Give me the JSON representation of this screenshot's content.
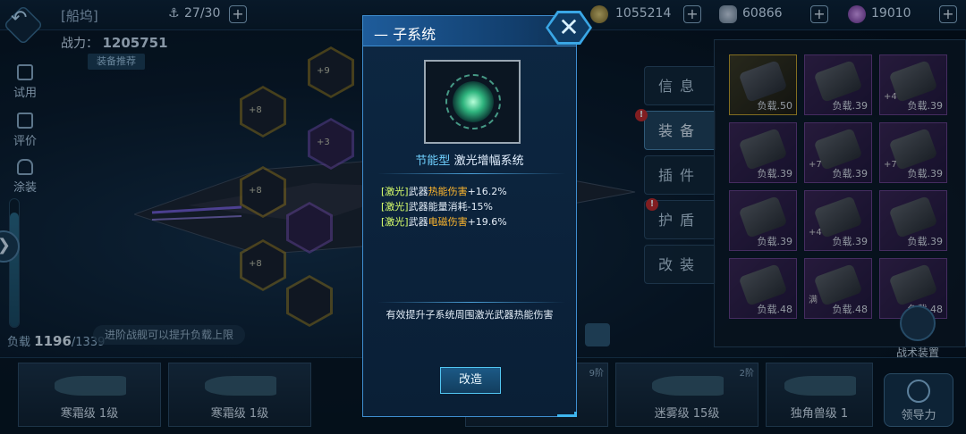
{
  "topbar": {
    "breadcrumb": "[船坞]",
    "fleet_count": "27/30",
    "gold": "1055214",
    "crystal": "60866",
    "gem": "19010"
  },
  "left": {
    "power_label": "战力：",
    "power_value": "1205751",
    "recommend": "装备推荐",
    "side_buttons": [
      "试用",
      "评价",
      "涂装"
    ],
    "load_label": "负载",
    "load_current": "1196",
    "load_max": "/1339",
    "load_fraction": 0.893,
    "hint": "进阶战舰可以提升负载上限"
  },
  "hex_badges": [
    "+9",
    "+8",
    "+3",
    "+8",
    "+8"
  ],
  "right_tabs": [
    "信息",
    "装备",
    "插件",
    "护盾",
    "改装"
  ],
  "tab_badge": "!",
  "inventory": [
    {
      "plus": "",
      "cap": "负载.50"
    },
    {
      "plus": "",
      "cap": "负载.39"
    },
    {
      "plus": "+4",
      "cap": "负载.39"
    },
    {
      "plus": "",
      "cap": "负载.39"
    },
    {
      "plus": "+7",
      "cap": "负载.39"
    },
    {
      "plus": "+7",
      "cap": "负载.39"
    },
    {
      "plus": "",
      "cap": "负载.39"
    },
    {
      "plus": "+4",
      "cap": "负载.39"
    },
    {
      "plus": "",
      "cap": "负载.39"
    },
    {
      "plus": "",
      "cap": "负载.48"
    },
    {
      "plus": "满",
      "cap": "负载.48"
    },
    {
      "plus": "",
      "cap": "负载.48"
    }
  ],
  "tactic_label": "战术装置",
  "ships": [
    {
      "name": "寒霜级 1级",
      "tier": ""
    },
    {
      "name": "寒霜级 1级",
      "tier": ""
    },
    {
      "name": "",
      "tier": "9阶"
    },
    {
      "name": "迷雾级 15级",
      "tier": "2阶"
    },
    {
      "name": "独角兽级 1",
      "tier": ""
    }
  ],
  "leader_label": "领导力",
  "modal": {
    "title": "子系统",
    "close": "✕",
    "item_type": "节能型",
    "item_name": "激光增幅系统",
    "attributes": [
      {
        "tag": "[激光]",
        "pre": "武器",
        "hl": "热能伤害",
        "post": "+16.2%"
      },
      {
        "tag": "[激光]",
        "pre": "武器能量消耗-15%",
        "hl": "",
        "post": ""
      },
      {
        "tag": "[激光]",
        "pre": "武器",
        "hl": "电磁伤害",
        "post": "+19.6%"
      }
    ],
    "description": "有效提升子系统周围激光武器热能伤害",
    "modify_button": "改造"
  }
}
